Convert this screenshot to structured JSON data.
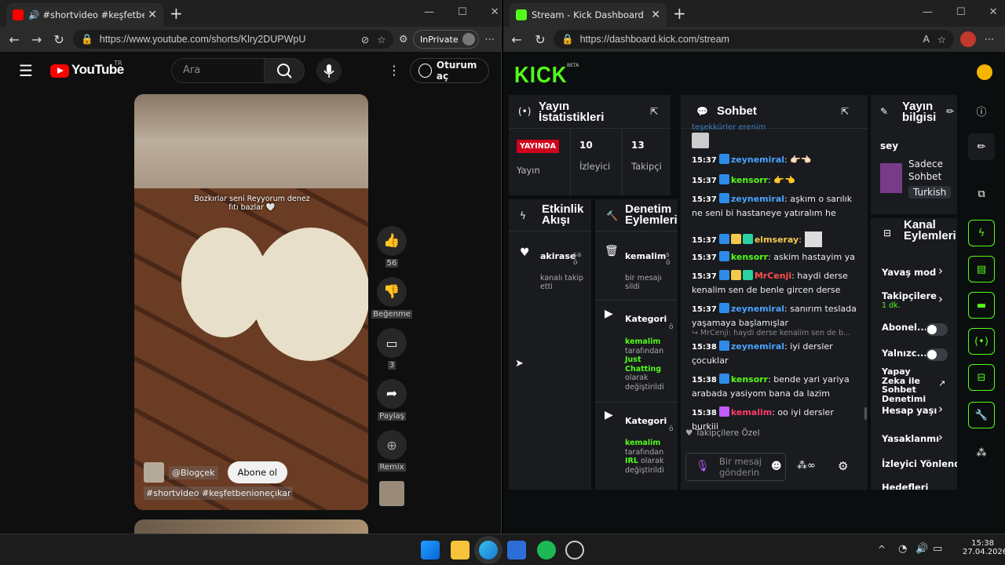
{
  "left": {
    "tab_title": "#shortvideo #keşfetbenioneç",
    "url_host": "https://www.youtube.com",
    "url_path": "/shorts/Klry2DUPWpU",
    "inprivate": "InPrivate",
    "yt": {
      "logo": "YouTube",
      "region": "TR",
      "search_placeholder": "Ara",
      "signin": "Oturum aç",
      "caption": "Bozkırlar seni Reyyorum denez fıtı bazlar 🤍",
      "channel": "@Blogçek",
      "subscribe": "Abone ol",
      "tags": "#shortvideo #keşfetbenioneçıkar",
      "likes": "56",
      "dislike": "Beğenme",
      "comments": "3",
      "share": "Paylaş",
      "remix": "Remix"
    }
  },
  "right": {
    "tab_title": "Stream - Kick Dashboard",
    "url": "https://dashboard.kick.com/stream",
    "logo": "KICK",
    "beta": "BETA",
    "stats": {
      "title1": "Yayın",
      "title2": "İstatistikleri",
      "live": "YAYINDA",
      "live_label": "Yayın",
      "viewers": "10",
      "viewers_label": "İzleyici",
      "followers": "13",
      "followers_label": "Takipçi"
    },
    "chat": {
      "title": "Sohbet",
      "placeholder": "Bir mesaj gönderin",
      "followers_only": "Takipçilere Özel",
      "top_partial": "teşekkürler erenim",
      "messages": [
        {
          "time": "15:37",
          "user": "zeynemiral",
          "color": "#4aa3ff",
          "text": ": 👉🏻👈🏻"
        },
        {
          "time": "15:37",
          "user": "kensorr",
          "color": "#53fc18",
          "text": ": 👉👈"
        },
        {
          "time": "15:37",
          "user": "zeynemiral",
          "color": "#4aa3ff",
          "text": ": aşkım o sarılık ne seni bi hastaneye yatıralım he"
        },
        {
          "time": "15:37",
          "user": "elmseray",
          "color": "#f2c94c",
          "text": ":"
        },
        {
          "time": "15:37",
          "user": "kensorr",
          "color": "#53fc18",
          "text": ": askim hastayim ya"
        },
        {
          "time": "15:37",
          "user": "MrCenji",
          "color": "#ff4d4d",
          "text": ": haydi derse kenalim sen de benle gircen derse"
        },
        {
          "time": "15:37",
          "user": "zeynemiral",
          "color": "#4aa3ff",
          "text": ": sanırım teslada yaşamaya başlamışlar"
        },
        {
          "time": "15:38",
          "user": "zeynemiral",
          "color": "#4aa3ff",
          "text": ": iyi dersler çocuklar"
        },
        {
          "time": "15:38",
          "user": "kensorr",
          "color": "#53fc18",
          "text": ": bende yari yariya arabada yasiyom bana da lazim"
        },
        {
          "time": "15:38",
          "user": "kemalim",
          "color": "#ff3b6b",
          "text": ": oo iyi dersler burkiii"
        }
      ],
      "reply": "MrCenji: haydi derse kenalim sen de b..."
    },
    "info": {
      "title1": "Yayın",
      "title2": "bilgisi",
      "stream_title": "sey",
      "cat1": "Sadece",
      "cat2": "Sohbet",
      "lang": "Turkish"
    },
    "activity": {
      "title1": "Etkinlik",
      "title2": "Akışı",
      "user": "akirase",
      "time": "sa ö",
      "text": "kanalı takip etti"
    },
    "mod": {
      "title1": "Denetim",
      "title2": "Eylemleri",
      "items": [
        {
          "user": "kemalim",
          "time": "s ö",
          "text": "bir mesajı sildi"
        },
        {
          "head": "Kategori",
          "time": "ö",
          "by": "kemalim",
          "t1": "tarafından",
          "cat": "Just Chatting",
          "t2": "olarak değiştirildi"
        },
        {
          "head": "Kategori",
          "time": "ö",
          "by": "kemalim",
          "t1": "tarafından",
          "cat": "IRL",
          "t2": "olarak değiştirildi"
        }
      ]
    },
    "channel": {
      "title1": "Kanal",
      "title2": "Eylemleri",
      "slow": "Yavaş mod",
      "followers": "Takipçilere",
      "followers_sub": "1 dk.",
      "subs": "Abonel...",
      "emotes": "Yalnızc...",
      "ai1": "Yapay",
      "ai2": "Zeka ile",
      "ai3": "Sohbet",
      "ai4": "Denetimi",
      "acc": "Hesap yaşı",
      "banned": "Yasaklanmı",
      "viewer_dir": "İzleyici Yönlendir",
      "more": "Hedefleri"
    }
  },
  "taskbar": {
    "time": "15:38",
    "date": "27.04.2026"
  }
}
